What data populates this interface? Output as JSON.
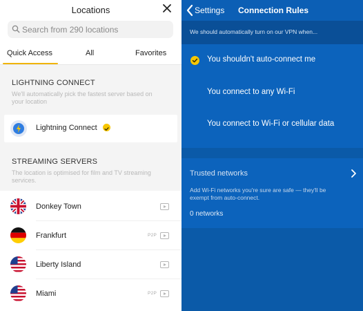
{
  "locations": {
    "title": "Locations",
    "search_placeholder": "Search from 290 locations",
    "tabs": [
      {
        "label": "Quick Access",
        "active": true
      },
      {
        "label": "All",
        "active": false
      },
      {
        "label": "Favorites",
        "active": false
      }
    ],
    "lightning": {
      "heading": "LIGHTNING CONNECT",
      "description": "We'll automatically pick the fastest server based on your location",
      "item_label": "Lightning Connect",
      "icon": "lightning-icon",
      "selected": true
    },
    "streaming": {
      "heading": "STREAMING SERVERS",
      "description": "The location is optimised for film and TV streaming services.",
      "servers": [
        {
          "name": "Donkey Town",
          "flag": "uk-flag-icon",
          "p2p": ""
        },
        {
          "name": "Frankfurt",
          "flag": "germany-flag-icon",
          "p2p": "P2P"
        },
        {
          "name": "Liberty Island",
          "flag": "usa-flag-icon",
          "p2p": ""
        },
        {
          "name": "Miami",
          "flag": "usa-flag-icon",
          "p2p": "P2P"
        }
      ]
    }
  },
  "rules": {
    "back_label": "Settings",
    "title": "Connection Rules",
    "intro": "We should automatically turn on our VPN when...",
    "options": [
      {
        "label": "You shouldn't auto-connect me",
        "selected": true
      },
      {
        "label": "You connect to any Wi-Fi",
        "selected": false
      },
      {
        "label": "You connect to Wi-Fi or cellular data",
        "selected": false
      }
    ],
    "trusted": {
      "title": "Trusted networks",
      "description": "Add Wi-Fi networks you're sure are safe — they'll be exempt from auto-connect.",
      "count": "0 networks"
    }
  },
  "colors": {
    "accent_yellow": "#f7c600",
    "panel_blue": "#0b5aa8",
    "option_blue": "#0c63bc"
  }
}
